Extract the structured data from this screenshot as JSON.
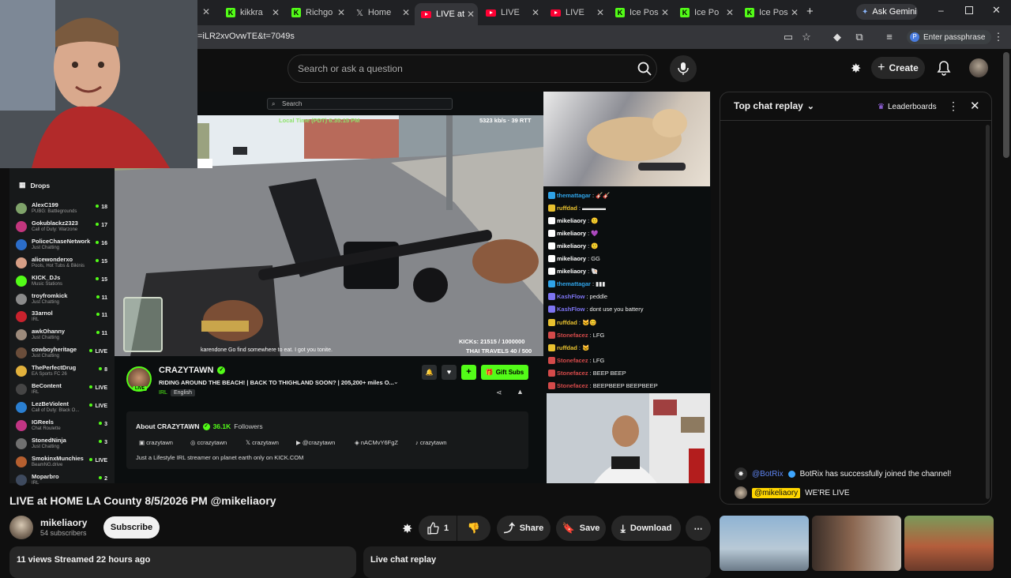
{
  "browser": {
    "tabs": [
      {
        "label": "kikkra",
        "type": "kick"
      },
      {
        "label": "Richgo",
        "type": "kick"
      },
      {
        "label": "Home",
        "type": "x"
      },
      {
        "label": "LIVE at",
        "type": "yt",
        "active": true
      },
      {
        "label": "LIVE",
        "type": "yt"
      },
      {
        "label": "LIVE",
        "type": "yt"
      },
      {
        "label": "Ice Pos",
        "type": "kick"
      },
      {
        "label": "Ice Po",
        "type": "kick"
      },
      {
        "label": "Ice Pos",
        "type": "kick"
      }
    ],
    "new_tab": "+",
    "ask_gemini": "Ask Gemini",
    "url": "=iLR2xvOvwTE&t=7049s",
    "passphrase": "Enter passphrase",
    "profile_initial": "P"
  },
  "youtube_header": {
    "search_placeholder": "Search or ask a question",
    "create_label": "Create"
  },
  "kick": {
    "sidebar_heading": "Drops",
    "streamers": [
      {
        "name": "AlexC199",
        "game": "PUBG: Battlegrounds",
        "count": "18",
        "color": "#7fa36a"
      },
      {
        "name": "Gokublackz2323",
        "game": "Call of Duty: Warzone",
        "count": "17",
        "color": "#c2367d"
      },
      {
        "name": "PoliceChaseNetwork",
        "game": "Just Chatting",
        "count": "16",
        "color": "#2b6dc9"
      },
      {
        "name": "alicewonderxo",
        "game": "Pools, Hot Tubs & Bikinis",
        "count": "15",
        "color": "#d79f86"
      },
      {
        "name": "KICK_DJs",
        "game": "Music Stations",
        "count": "15",
        "color": "#53fc18"
      },
      {
        "name": "troyfromkick",
        "game": "Just Chatting",
        "count": "11",
        "color": "#8b8b8b"
      },
      {
        "name": "33arnol",
        "game": "IRL",
        "count": "11",
        "color": "#c8222d"
      },
      {
        "name": "awkOhanny",
        "game": "Just Chatting",
        "count": "11",
        "color": "#9c8a7b"
      },
      {
        "name": "cowboyheritage",
        "game": "Just Chatting",
        "count": "LIVE",
        "color": "#6a4d3a"
      },
      {
        "name": "ThePerfectDrug",
        "game": "EA Sports FC 26",
        "count": "8",
        "color": "#e2b13c"
      },
      {
        "name": "BeContent",
        "game": "IRL",
        "count": "LIVE",
        "color": "#454545"
      },
      {
        "name": "LezBeViolent",
        "game": "Call of Duty: Black O...",
        "count": "LIVE",
        "color": "#2a7fd1"
      },
      {
        "name": "IGReels",
        "game": "Chat Roulette",
        "count": "3",
        "color": "#c13584"
      },
      {
        "name": "StonedNinja",
        "game": "Just Chatting",
        "count": "3",
        "color": "#707070"
      },
      {
        "name": "SmokinxMunchies",
        "game": "BeamNG.drive",
        "count": "LIVE",
        "color": "#b55f2f"
      },
      {
        "name": "Moparbro",
        "game": "IRL",
        "count": "2",
        "color": "#3e4a5e"
      }
    ],
    "search_placeholder": "Search",
    "overlay_time": "Local Time (PDT) 6:35:15 PM",
    "overlay_bitrate": "5323 kb/s · 39 RTT",
    "overlay_kicks": "KICKs: 21515 / 1000000",
    "overlay_travels": "THAI TRAVELS 40 / 500",
    "overlay_ticker": "karendone Go find somewhere to eat. I got you tonite.",
    "channel_name": "CRAZYTAWN",
    "live_badge": "LIVE",
    "stream_title": "RIDING AROUND THE BEACH! | BACK TO THIGHLAND SOON? | 205,200+ miles O...",
    "tags": [
      "IRL",
      "English"
    ],
    "gift_subs": "Gift Subs",
    "about_title": "About CRAZYTAWN",
    "followers_count": "36.1K",
    "followers_label": "Followers",
    "socials": [
      "crazytawn",
      "ccrazytawn",
      "crazytawn",
      "@crazytawn",
      "nACMvY6FgZ",
      "crazytawn"
    ],
    "about_text": "Just a Lifestyle IRL streamer on planet earth only on KICK.COM",
    "chat": [
      {
        "user": "themattagar",
        "color": "#2fa3e8",
        "text": "🎸🎸"
      },
      {
        "user": "ruffdad",
        "color": "#e8c12f",
        "text": "▬▬▬▬"
      },
      {
        "user": "mikeliaory",
        "color": "#ffffff",
        "text": "🙂"
      },
      {
        "user": "mikeliaory",
        "color": "#ffffff",
        "text": "💜"
      },
      {
        "user": "mikeliaory",
        "color": "#ffffff",
        "text": "🙂"
      },
      {
        "user": "mikeliaory",
        "color": "#ffffff",
        "text": "GG"
      },
      {
        "user": "mikeliaory",
        "color": "#ffffff",
        "text": "🐚"
      },
      {
        "user": "themattagar",
        "color": "#2fa3e8",
        "text": "▮▮▮"
      },
      {
        "user": "KashFlow",
        "color": "#7d74f2",
        "text": "peddle"
      },
      {
        "user": "KashFlow",
        "color": "#7d74f2",
        "text": "dont use you battery"
      },
      {
        "user": "ruffdad",
        "color": "#e8c12f",
        "text": "🐱😊"
      },
      {
        "user": "Stonefacez",
        "color": "#d44a4a",
        "text": "LFG"
      },
      {
        "user": "ruffdad",
        "color": "#e8c12f",
        "text": "🐱"
      },
      {
        "user": "Stonefacez",
        "color": "#d44a4a",
        "text": "LFG"
      },
      {
        "user": "Stonefacez",
        "color": "#d44a4a",
        "text": "BEEP BEEP"
      },
      {
        "user": "Stonefacez",
        "color": "#d44a4a",
        "text": "BEEPBEEP BEEPBEEP"
      }
    ]
  },
  "live_chat": {
    "header": "Top chat replay",
    "leaderboards": "Leaderboards",
    "messages": [
      {
        "user": "@BotRix",
        "text": "BotRix has successfully joined the channel!"
      },
      {
        "user": "@mikeliaory",
        "text": "WE'RE LIVE"
      }
    ]
  },
  "video": {
    "title": "LIVE at HOME LA County 8/5/2026 PM @mikeliaory",
    "channel": "mikeliaory",
    "subscribers": "54 subscribers",
    "subscribe": "Subscribe",
    "likes": "1",
    "share": "Share",
    "save": "Save",
    "download": "Download",
    "views_line": "11 views  Streamed 22 hours ago",
    "live_chat_replay": "Live chat replay"
  }
}
